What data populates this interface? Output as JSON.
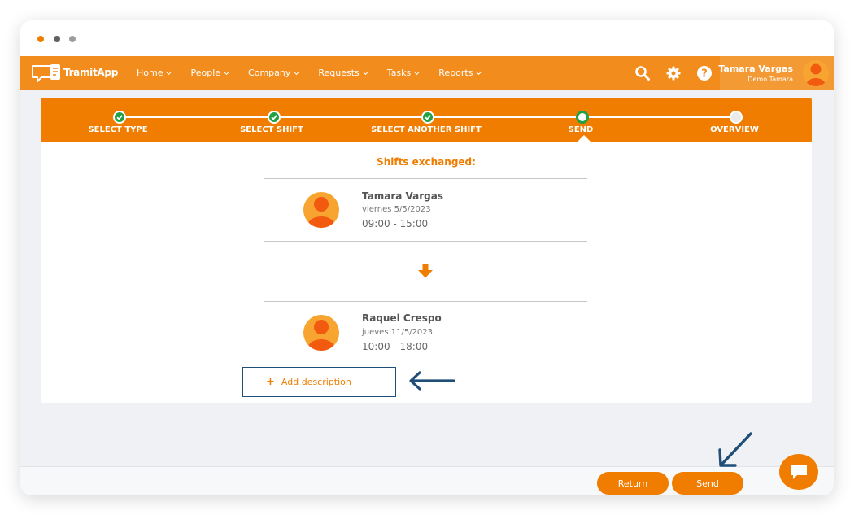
{
  "window": {
    "controls": [
      "close-dot",
      "minimize-dot",
      "maximize-dot"
    ]
  },
  "navbar": {
    "logo_text": "TramitApp",
    "menu": [
      "Home",
      "People",
      "Company",
      "Requests",
      "Tasks",
      "Reports"
    ],
    "icons": [
      "search-icon",
      "gear-icon",
      "help-icon"
    ],
    "user": {
      "name": "Tamara Vargas",
      "company": "Demo Tamara"
    }
  },
  "stepper": {
    "steps": [
      {
        "label": "SELECT TYPE",
        "state": "done"
      },
      {
        "label": "SELECT SHIFT",
        "state": "done"
      },
      {
        "label": "SELECT ANOTHER SHIFT",
        "state": "done"
      },
      {
        "label": "SEND",
        "state": "current"
      },
      {
        "label": "OVERVIEW",
        "state": "pending"
      }
    ]
  },
  "content": {
    "title": "Shifts exchanged:",
    "shifts": [
      {
        "name": "Tamara Vargas",
        "date": "viernes 5/5/2023",
        "time": "09:00 - 15:00"
      },
      {
        "name": "Raquel Crespo",
        "date": "jueves 11/5/2023",
        "time": "10:00 - 18:00"
      }
    ],
    "add_description": "Add description"
  },
  "footer": {
    "return_label": "Return",
    "send_label": "Send"
  },
  "colors": {
    "brand": "#f07d00",
    "nav": "#f28c1c",
    "success": "#23a046",
    "annotation": "#1f4e79"
  }
}
